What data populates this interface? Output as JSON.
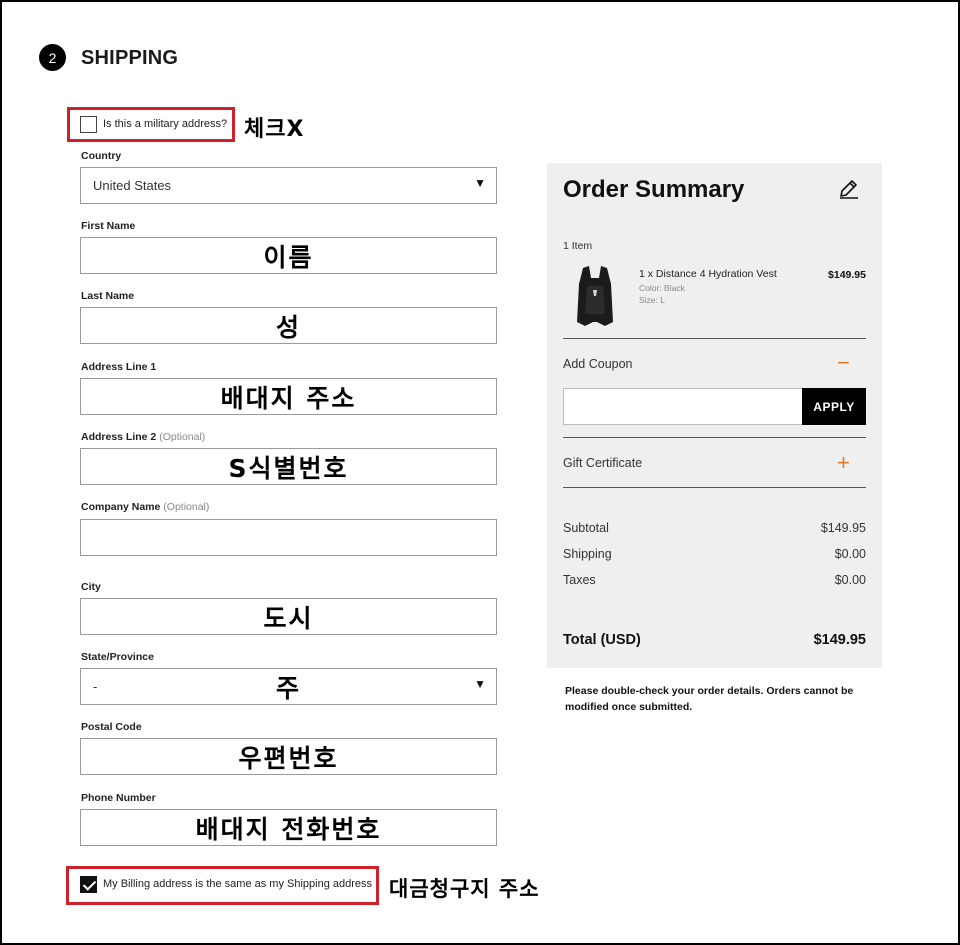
{
  "section": {
    "step_number": "2",
    "title": "SHIPPING"
  },
  "military": {
    "label": "Is this a military address?",
    "checked": false,
    "annotation": "체크X"
  },
  "fields": {
    "country": {
      "label": "Country",
      "value": "United States"
    },
    "first_name": {
      "label": "First Name",
      "value": "이름"
    },
    "last_name": {
      "label": "Last Name",
      "value": "성"
    },
    "address1": {
      "label": "Address Line 1",
      "value": "배대지 주소"
    },
    "address2": {
      "label": "Address Line 2",
      "optional": "(Optional)",
      "value": "S식별번호"
    },
    "company": {
      "label": "Company Name",
      "optional": "(Optional)",
      "value": ""
    },
    "city": {
      "label": "City",
      "value": "도시"
    },
    "state": {
      "label": "State/Province",
      "selected": "-",
      "value": "주"
    },
    "postal": {
      "label": "Postal Code",
      "value": "우편번호"
    },
    "phone": {
      "label": "Phone Number",
      "value": "배대지 전화번호"
    }
  },
  "billing": {
    "label": "My Billing address is the same as my Shipping address",
    "checked": true,
    "annotation": "대금청구지 주소"
  },
  "summary": {
    "title": "Order Summary",
    "item_count": "1 Item",
    "product": {
      "name": "1 x Distance 4 Hydration Vest",
      "color": "Color: Black",
      "size": "Size: L",
      "price": "$149.95"
    },
    "coupon_label": "Add Coupon",
    "coupon_toggle": "−",
    "coupon_value": "",
    "apply_label": "APPLY",
    "gift_label": "Gift Certificate",
    "gift_toggle": "+",
    "subtotal_label": "Subtotal",
    "subtotal_value": "$149.95",
    "shipping_label": "Shipping",
    "shipping_value": "$0.00",
    "taxes_label": "Taxes",
    "taxes_value": "$0.00",
    "total_label": "Total (USD)",
    "total_value": "$149.95"
  },
  "note": "Please double-check your order details. Orders cannot be modified once submitted.",
  "colors": {
    "annotation_box": "#d0212b",
    "accent": "#e0782a",
    "panel_bg": "#efefef"
  }
}
